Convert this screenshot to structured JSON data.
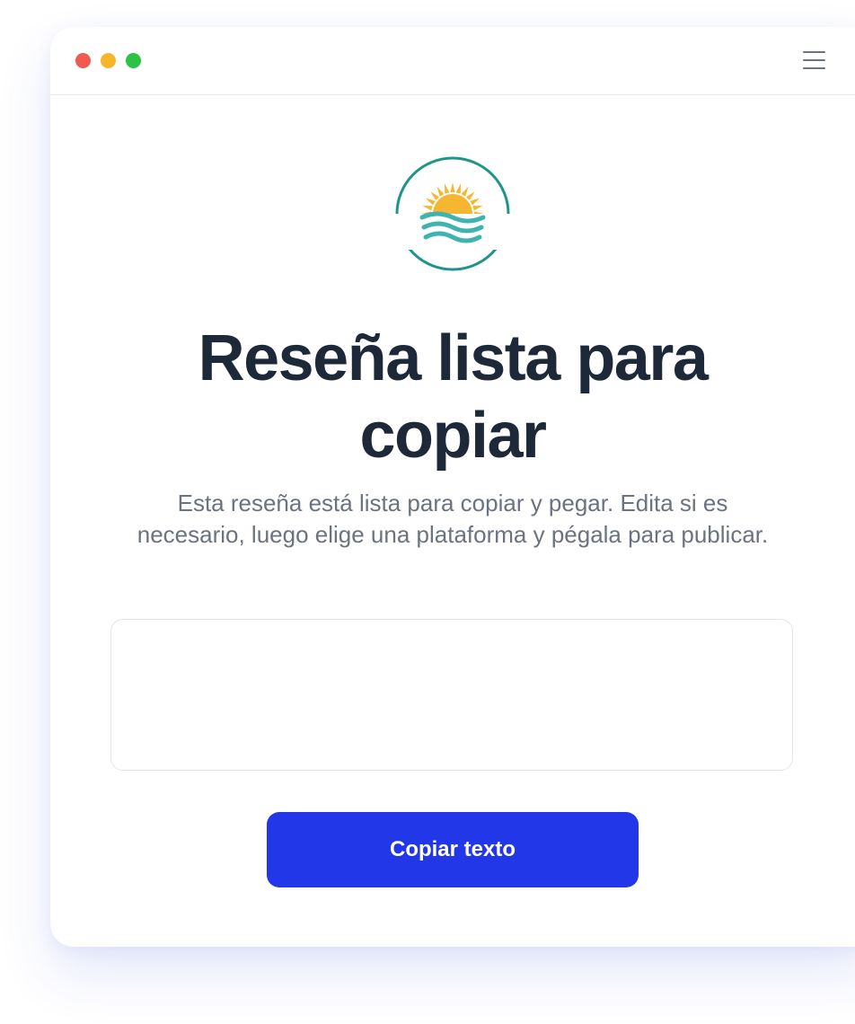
{
  "window": {
    "controls": {
      "close_color": "#f05a50",
      "minimize_color": "#f7b52c",
      "maximize_color": "#2cc244"
    },
    "menu_icon": "hamburger-menu-icon"
  },
  "logo": {
    "icon": "sun-over-waves-logo",
    "ring_color": "#1f958a",
    "sun_color": "#f5b731",
    "wave_color": "#3fb3b0"
  },
  "main": {
    "title": "Reseña lista para copiar",
    "description": "Esta reseña está lista para copiar y pegar. Edita si es necesario, luego elige una plataforma y pégala para publicar.",
    "review_text": "",
    "copy_button_label": "Copiar texto"
  },
  "colors": {
    "accent": "#2137e8",
    "heading": "#1d2939",
    "muted_text": "#6b7280"
  }
}
